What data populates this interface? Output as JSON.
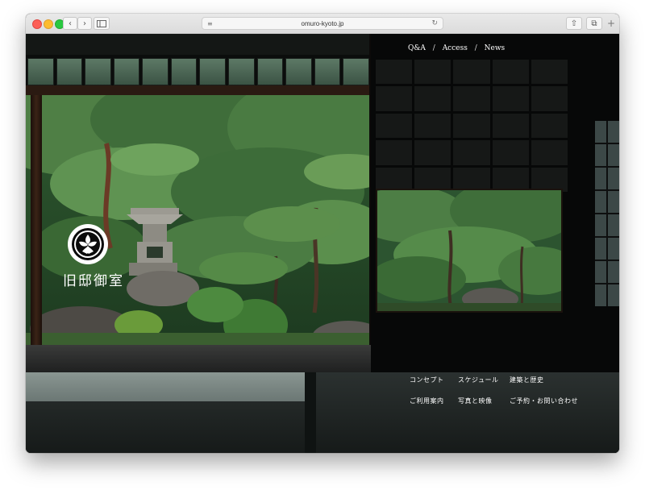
{
  "browser": {
    "url": "omuro-kyoto.jp",
    "back_icon": "chevron-left-icon",
    "forward_icon": "chevron-right-icon",
    "sidebar_icon": "sidebar-icon",
    "reader_icon": "reader-icon",
    "reload_icon": "reload-icon",
    "share_icon": "share-icon",
    "tabs_icon": "tabs-icon",
    "new_tab_icon": "plus-icon"
  },
  "header_nav": {
    "items": [
      "Q&A",
      "Access",
      "News"
    ],
    "separator": "/"
  },
  "site": {
    "logo_icon": "crest-icon",
    "logo_text": "旧邸御室"
  },
  "menu": {
    "row1": [
      "コンセプト",
      "スケジュール",
      "建築と歴史"
    ],
    "row2": [
      "ご利用案内",
      "写真と映像",
      "ご予約・お問い合わせ"
    ]
  },
  "colors": {
    "background": "#070908",
    "text": "#ffffff",
    "garden_green": "#3e6b38"
  }
}
